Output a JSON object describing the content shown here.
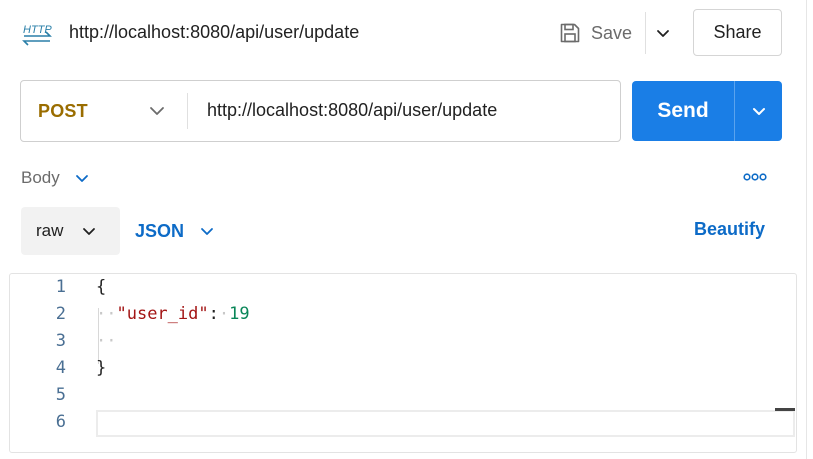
{
  "header": {
    "icon_label": "HTTP",
    "title": "http://localhost:8080/api/user/update",
    "save_label": "Save",
    "share_label": "Share"
  },
  "request": {
    "method": "POST",
    "url": "http://localhost:8080/api/user/update",
    "send_label": "Send"
  },
  "body_section": {
    "tab_label": "Body",
    "format_mode": "raw",
    "language": "JSON",
    "beautify_label": "Beautify"
  },
  "editor": {
    "lines": [
      {
        "number": "1",
        "tokens": [
          {
            "type": "brace",
            "text": "{"
          }
        ]
      },
      {
        "number": "2",
        "tokens": [
          {
            "type": "ws-dot",
            "text": "··"
          },
          {
            "type": "str-key",
            "text": "\"user_id\""
          },
          {
            "type": "punct",
            "text": ":"
          },
          {
            "type": "ws-dot",
            "text": "·"
          },
          {
            "type": "num",
            "text": "19"
          }
        ]
      },
      {
        "number": "3",
        "tokens": [
          {
            "type": "ws-dot",
            "text": "··"
          }
        ]
      },
      {
        "number": "4",
        "tokens": [
          {
            "type": "brace",
            "text": "}"
          }
        ]
      },
      {
        "number": "5",
        "tokens": []
      },
      {
        "number": "6",
        "tokens": []
      }
    ]
  },
  "colors": {
    "send_button": "#1a7ee6",
    "method_post": "#9a6d00",
    "link_blue": "#0d6bc7",
    "json_key": "#a31515",
    "json_number": "#098658"
  },
  "icons": {
    "request_type": "http-icon",
    "save": "floppy-disk-icon",
    "dropdown": "chevron-down-icon",
    "more": "more-horizontal-icon"
  }
}
